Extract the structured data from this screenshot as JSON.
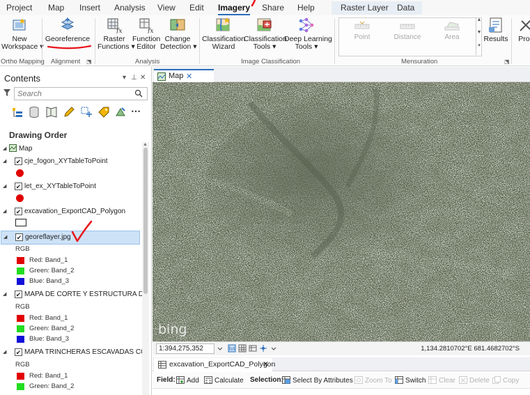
{
  "menu": {
    "tabs": [
      {
        "label": "Project"
      },
      {
        "label": "Map"
      },
      {
        "label": "Insert"
      },
      {
        "label": "Analysis"
      },
      {
        "label": "View"
      },
      {
        "label": "Edit"
      },
      {
        "label": "Imagery"
      },
      {
        "label": "Share"
      },
      {
        "label": "Help"
      }
    ],
    "active": "Imagery",
    "context_tabs": [
      {
        "label": "Raster Layer"
      },
      {
        "label": "Data"
      }
    ]
  },
  "ribbon": {
    "new_workspace": {
      "line1": "New",
      "line2": "Workspace ▾"
    },
    "georeference": {
      "label": "Georeference"
    },
    "raster_functions": {
      "line1": "Raster",
      "line2": "Functions ▾"
    },
    "function_editor": {
      "line1": "Function",
      "line2": "Editor"
    },
    "change_detection": {
      "line1": "Change",
      "line2": "Detection ▾"
    },
    "classification_wizard": {
      "line1": "Classification",
      "line2": "Wizard"
    },
    "classification_tools": {
      "line1": "Classification",
      "line2": "Tools ▾"
    },
    "deep_learning_tools": {
      "line1": "Deep Learning",
      "line2": "Tools ▾"
    },
    "mensuration_point": {
      "label": "Point"
    },
    "mensuration_distance": {
      "label": "Distance"
    },
    "mensuration_area": {
      "label": "Area"
    },
    "results": {
      "label": "Results"
    },
    "processing_partial": {
      "label": "Proc"
    },
    "groups": {
      "ortho_mapping": "Ortho Mapping",
      "alignment": "Alignment",
      "analysis": "Analysis",
      "image_classification": "Image Classification",
      "mensuration": "Mensuration"
    }
  },
  "contents": {
    "title": "Contents",
    "search_placeholder": "Search",
    "drawing_order": "Drawing Order",
    "map_label": "Map",
    "layers": [
      {
        "name": "cje_fogon_XYTableToPoint",
        "checked": "✔"
      },
      {
        "name": "let_ex_XYTableToPoint",
        "checked": "✔"
      },
      {
        "name": "excavation_ExportCAD_Polygon",
        "checked": "✔"
      },
      {
        "name": "georeflayer.jpg",
        "checked": "✔"
      },
      {
        "name": "MAPA DE CORTE Y ESTRUCTURA DE E...",
        "checked": "✔"
      },
      {
        "name": "MAPA TRINCHERAS ESCAVADAS COJ...",
        "checked": "✔"
      }
    ],
    "rgb_label": "RGB",
    "bands": {
      "red": "Red:   Band_1",
      "green": "Green: Band_2",
      "blue": "Blue:  Band_3"
    }
  },
  "map": {
    "tab_label": "Map",
    "attribution": "bing",
    "scale": "1:394,275,352",
    "coordinates": "1,134.2810702°E 681.4682702°S"
  },
  "attribute_table": {
    "tab_label": "excavation_ExportCAD_Polygon",
    "field_label": "Field:",
    "add": "Add",
    "calculate": "Calculate",
    "selection_label": "Selection:",
    "select_by_attributes": "Select By Attributes",
    "zoom_to": "Zoom To",
    "switch": "Switch",
    "clear": "Clear",
    "delete": "Delete",
    "copy": "Copy"
  },
  "colors": {
    "accent": "#2a6ebb",
    "selection": "#cde2f7",
    "annotation_red": "#e8141b",
    "point_symbol": "#e10000",
    "band_red": "#e10000",
    "band_green": "#22dd22",
    "band_blue": "#1010d8"
  }
}
